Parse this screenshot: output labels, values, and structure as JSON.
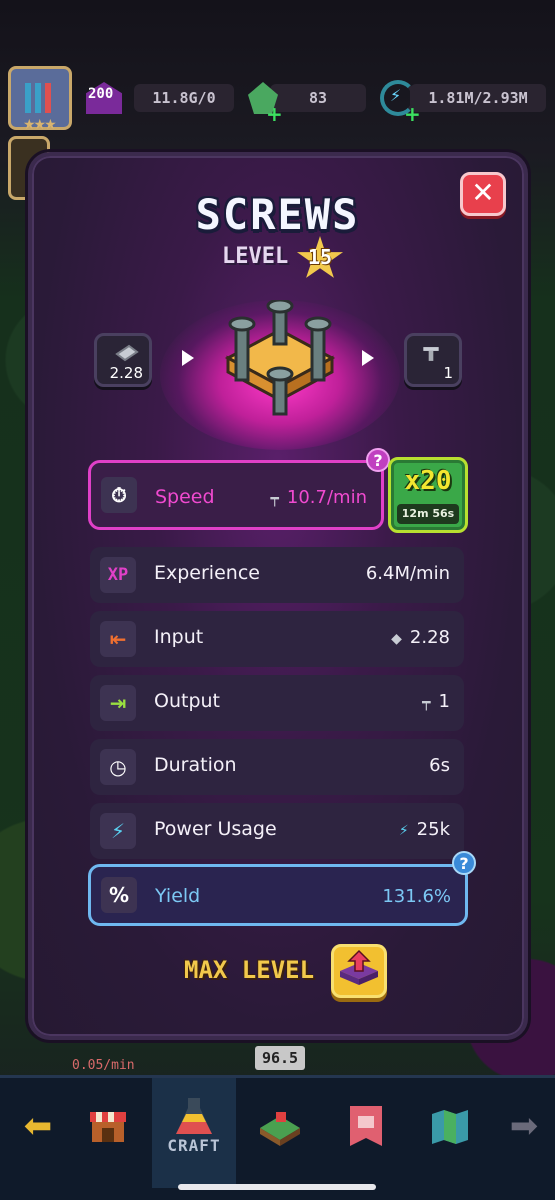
{
  "hud": {
    "player_level": "200",
    "gold": "11.8G/0",
    "gems": "83",
    "power": "1.81M/2.93M"
  },
  "modal": {
    "title": "SCREWS",
    "level_label": "LEVEL",
    "level_value": "15",
    "close_label": "✕",
    "input_amount": "2.28",
    "output_amount": "1",
    "speed": {
      "label": "Speed",
      "value": "10.7/min",
      "help": "?"
    },
    "boost": {
      "multiplier": "x20",
      "timer": "12m 56s"
    },
    "stats": [
      {
        "label": "Experience",
        "value": "6.4M/min",
        "icon": "xp-icon"
      },
      {
        "label": "Input",
        "value": "2.28",
        "icon": "input-icon"
      },
      {
        "label": "Output",
        "value": "1",
        "icon": "output-icon"
      },
      {
        "label": "Duration",
        "value": "6s",
        "icon": "clock-icon"
      },
      {
        "label": "Power Usage",
        "value": "25k",
        "icon": "lightning-icon"
      }
    ],
    "yield": {
      "label": "Yield",
      "value": "131.6%",
      "help": "?"
    },
    "max_level_label": "MAX LEVEL"
  },
  "background": {
    "strip_value": "96.5",
    "strip_rate": "0.05/min"
  },
  "bottom_nav": {
    "craft_label": "CRAFT"
  },
  "colors": {
    "accent_pink": "#e040c8",
    "accent_blue": "#6fb8f0",
    "gold": "#f2c94c",
    "boost_green": "#3aa848",
    "close_red": "#e8404c"
  }
}
